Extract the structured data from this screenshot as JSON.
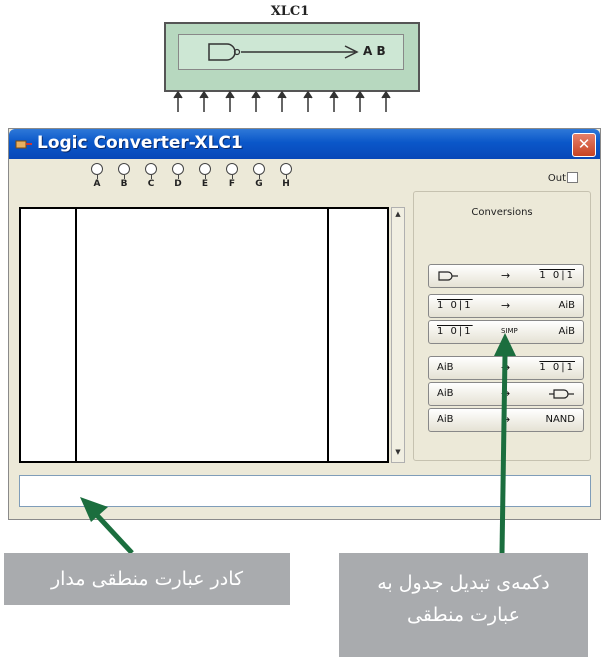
{
  "component": {
    "title": "XLC1",
    "output_label": "A B"
  },
  "window": {
    "title": "Logic Converter-XLC1",
    "close_label": "✕",
    "inputs": [
      "A",
      "B",
      "C",
      "D",
      "E",
      "F",
      "G",
      "H"
    ],
    "out_label": "Out",
    "out_checked": false,
    "conversions": {
      "title": "Conversions",
      "buttons": [
        {
          "from": "circuit",
          "arrow": "→",
          "to": "1 0|1"
        },
        {
          "from": "1 0|1",
          "arrow": "→",
          "to": "AiB"
        },
        {
          "from": "1 0|1",
          "arrow": "SIMP",
          "to": "AiB"
        },
        {
          "from": "AiB",
          "arrow": "→",
          "to": "1 0|1"
        },
        {
          "from": "AiB",
          "arrow": "→",
          "to": "circuit"
        },
        {
          "from": "AiB",
          "arrow": "→",
          "to": "NAND"
        }
      ]
    },
    "expression_value": ""
  },
  "callouts": {
    "left": "کادر عبارت منطقی مدار",
    "right_line1": "دکمه‌ی تبدیل جدول به",
    "right_line2": "عبارت منطقی"
  },
  "colors": {
    "titlebar": "#0a57c9",
    "component_fill": "#b7d8bf",
    "arrow_green": "#1b6e3e",
    "callout_bg": "#a9abae"
  }
}
